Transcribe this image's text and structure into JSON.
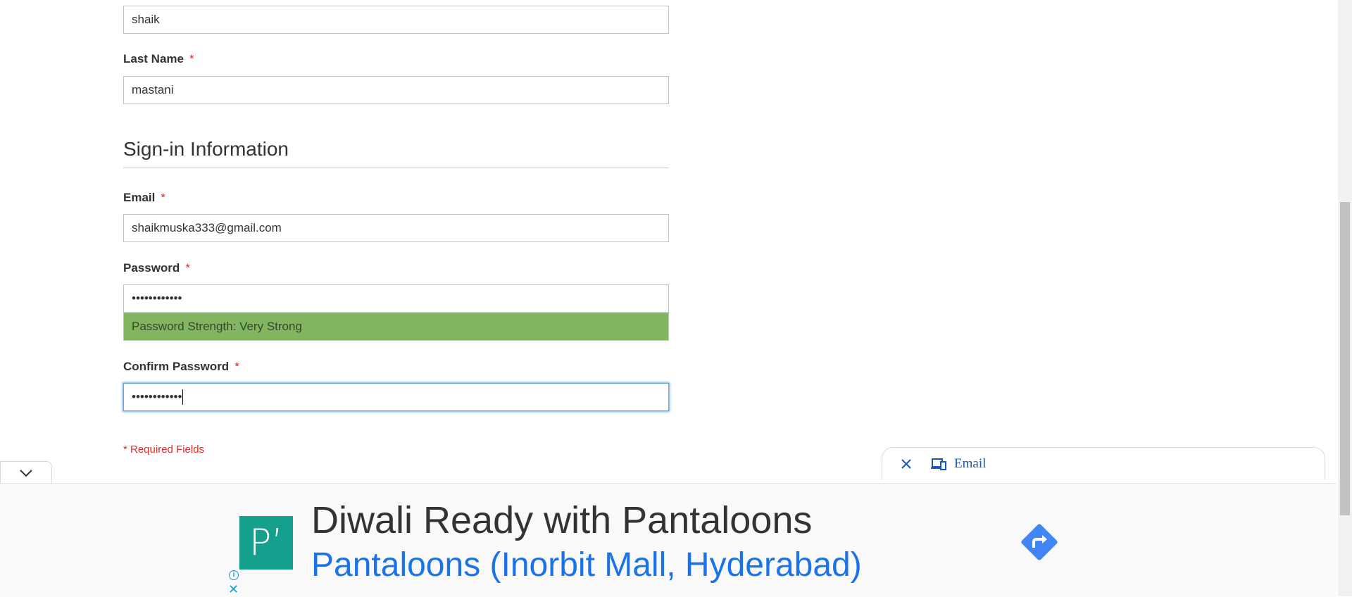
{
  "form": {
    "first_name_value": "shaik",
    "last_name_label": "Last Name",
    "last_name_value": "mastani",
    "section_title": "Sign-in Information",
    "email_label": "Email",
    "email_value": "shaikmuska333@gmail.com",
    "password_label": "Password",
    "password_value": "••••••••••••",
    "password_strength": "Password Strength: Very Strong",
    "confirm_password_label": "Confirm Password",
    "confirm_password_value": "••••••••••••",
    "required_mark": "*",
    "required_note": "* Required Fields"
  },
  "autofill_toast": {
    "label": "Email",
    "icons": [
      "close-icon",
      "devices-icon"
    ]
  },
  "ad": {
    "logo_text": "P’",
    "title": "Diwali Ready with Pantaloons",
    "subtitle": "Pantaloons (Inorbit Mall, Hyderabad)",
    "icons": [
      "directions-icon",
      "info-icon",
      "close-icon"
    ]
  },
  "colors": {
    "required": "#e02b27",
    "strength_bar": "#82b560",
    "focus": "#68a8e0",
    "ad_link": "#1a73e8",
    "ad_logo": "#15a08d"
  }
}
